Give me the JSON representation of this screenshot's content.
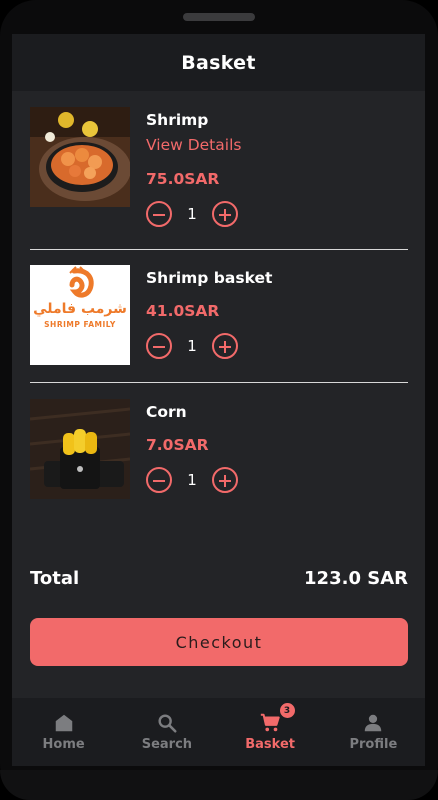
{
  "header": {
    "title": "Basket"
  },
  "items": [
    {
      "name": "Shrimp",
      "link": "View Details",
      "price": "75.0SAR",
      "quantity": "1"
    },
    {
      "name": "Shrimp basket",
      "price": "41.0SAR",
      "quantity": "1",
      "logo_text_ar": "شرمب فاملي",
      "logo_text_en": "SHRIMP FAMILY"
    },
    {
      "name": "Corn",
      "price": "7.0SAR",
      "quantity": "1"
    }
  ],
  "summary": {
    "total_label": "Total",
    "total_value": "123.0 SAR"
  },
  "checkout": {
    "label": "Checkout"
  },
  "nav": {
    "items": [
      {
        "label": "Home",
        "icon": "home-icon"
      },
      {
        "label": "Search",
        "icon": "search-icon"
      },
      {
        "label": "Basket",
        "icon": "cart-icon",
        "badge": "3",
        "active": true
      },
      {
        "label": "Profile",
        "icon": "person-icon"
      }
    ]
  },
  "colors": {
    "accent": "#f26a6a",
    "background": "#232427",
    "bar": "#1b1c1f",
    "muted": "#7c7d80"
  }
}
